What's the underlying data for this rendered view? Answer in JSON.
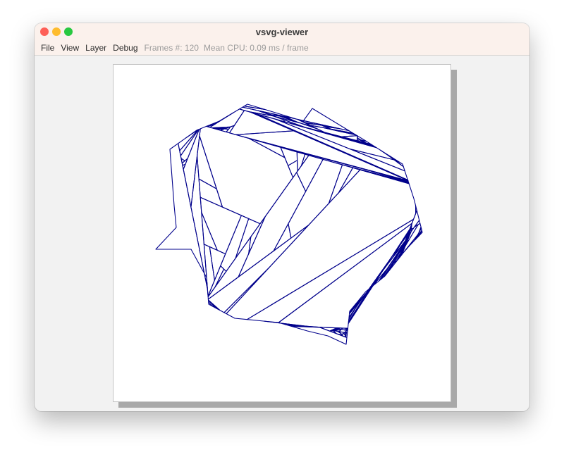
{
  "window": {
    "title": "vsvg-viewer"
  },
  "menu": {
    "items": [
      "File",
      "View",
      "Layer",
      "Debug"
    ]
  },
  "stats": {
    "frames": "Frames #: 120",
    "cpu": "Mean CPU: 0.09 ms / frame"
  },
  "drawing": {
    "stroke_color": "#00008b",
    "background_color": "#ffffff",
    "description": "voronoi-fractal"
  },
  "icons": {
    "close": "close-icon",
    "minimize": "minimize-icon",
    "maximize": "maximize-icon"
  }
}
